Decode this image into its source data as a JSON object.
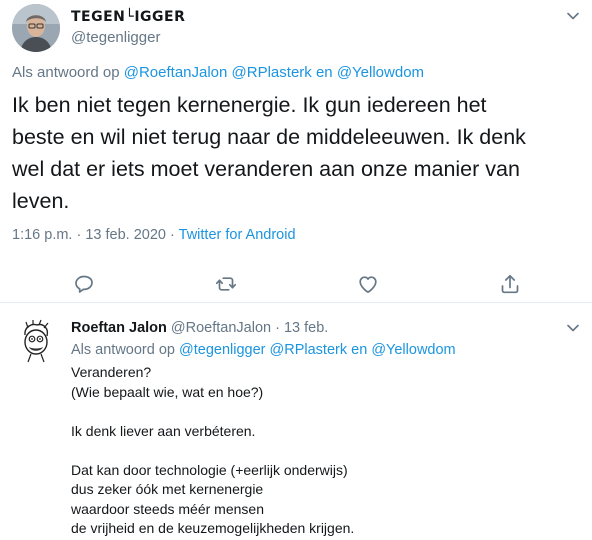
{
  "main_tweet": {
    "author_name": "TEGEN└IGGER",
    "author_handle": "@tegenligger",
    "reply_prefix": "Als antwoord op ",
    "reply_mentions": [
      "@RoeftanJalon",
      "@RPlasterk"
    ],
    "reply_conjunction": "en",
    "reply_last_mention": "@Yellowdom",
    "text_lines": [
      "Ik ben niet tegen kernenergie. Ik gun iedereen het",
      "beste en wil niet terug naar de middeleeuwen. Ik denk",
      "wel dat er iets moet veranderen aan onze manier van",
      "leven."
    ],
    "time": "1:16 p.m.",
    "date": "13 feb. 2020",
    "separator": "·",
    "source": "Twitter for Android",
    "actions": [
      {
        "name": "reply",
        "icon": "reply-icon"
      },
      {
        "name": "retweet",
        "icon": "retweet-icon"
      },
      {
        "name": "like",
        "icon": "heart-icon"
      },
      {
        "name": "share",
        "icon": "share-icon"
      }
    ]
  },
  "reply_tweet": {
    "author_name": "Roeftan Jalon",
    "author_handle": "@RoeftanJalon",
    "separator": "·",
    "date": "13 feb.",
    "reply_prefix": "Als antwoord op ",
    "reply_mentions": [
      "@tegenligger",
      "@RPlasterk"
    ],
    "reply_conjunction": "en",
    "reply_last_mention": "@Yellowdom",
    "text_lines": [
      "Veranderen?",
      "(Wie bepaalt wie, wat en hoe?)",
      "",
      "Ik denk liever aan verbéteren.",
      "",
      "Dat kan door technologie (+eerlijk onderwijs)",
      "dus zeker óók met kernenergie",
      "waardoor steeds méér mensen",
      "de vrijheid en de keuzemogelijkheden krijgen."
    ]
  },
  "colors": {
    "text": "#14171a",
    "secondary": "#657786",
    "link": "#1b95e0",
    "divider": "#e6ecf0"
  }
}
